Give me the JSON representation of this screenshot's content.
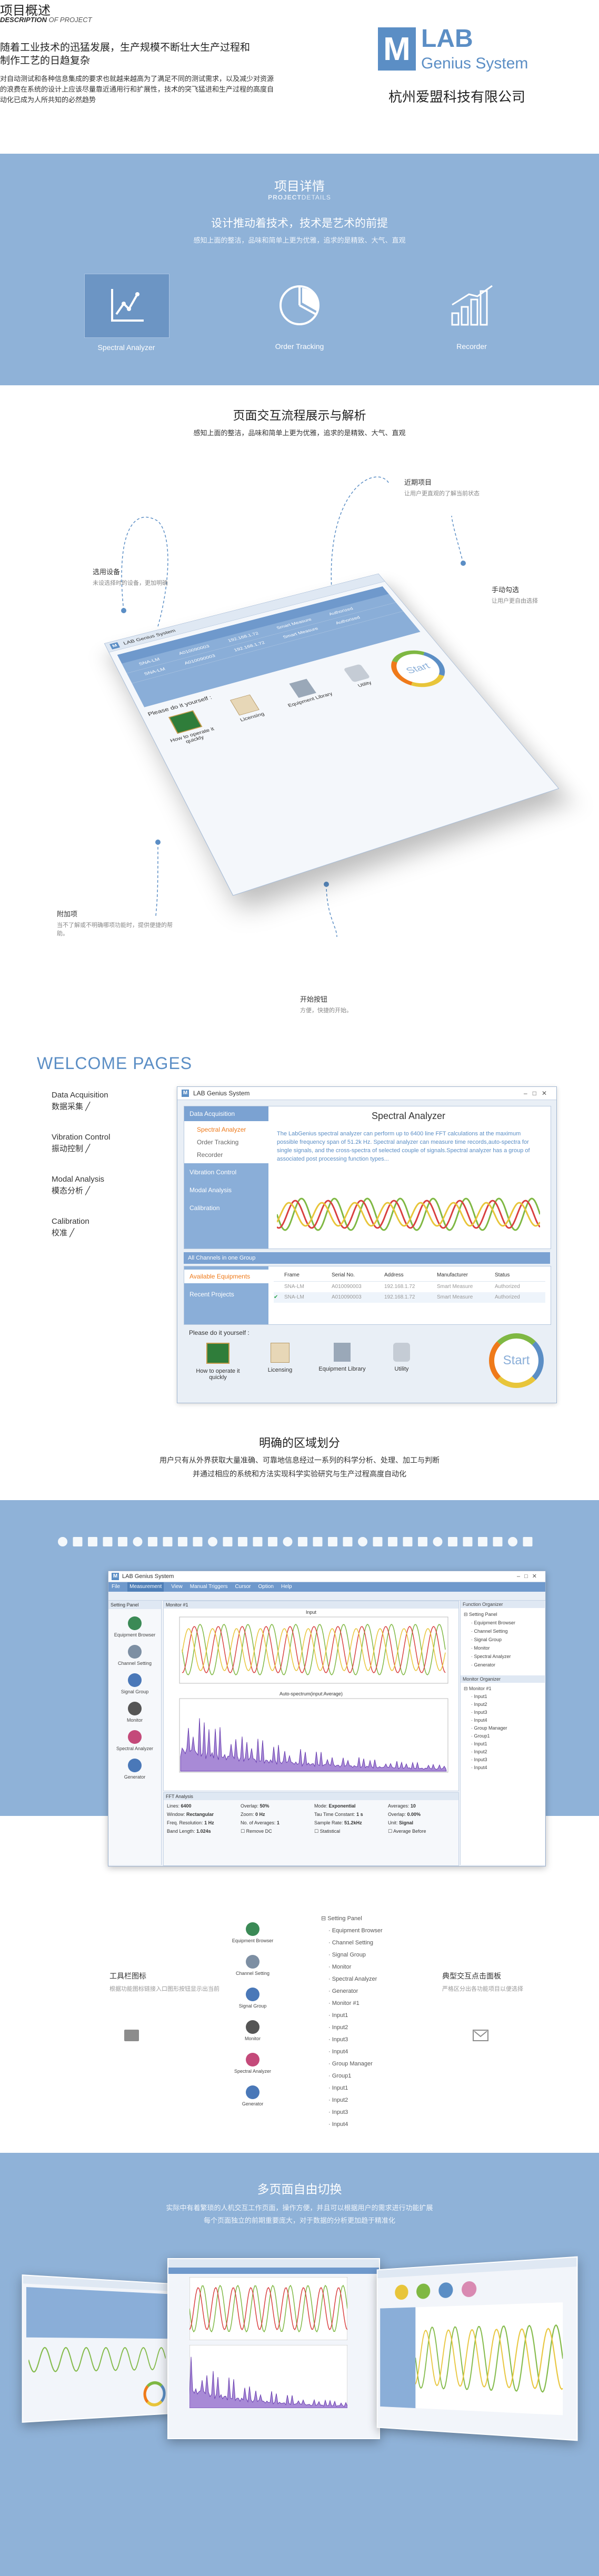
{
  "header": {
    "title": "项目概述",
    "subtitle_en_bold": "DESCRIPTION",
    "subtitle_en": "OF PROJECT",
    "lead": "随着工业技术的迅猛发展，生产规模不断壮大生产过程和制作工艺的日趋复杂",
    "body": "对自动测试和各种信息集成的要求也就越来越高为了满足不同的测试需求，以及减少对资源的浪费在系统的设计上应该尽量靠近通用行和扩展性，技术的突飞猛进和生产过程的高度自动化已成为人所共知的必然趋势"
  },
  "logo": {
    "mark": "M",
    "lab": "LAB",
    "genius": "Genius System",
    "company": "杭州爱盟科技有限公司"
  },
  "details": {
    "title": "项目详情",
    "subtitle_bold": "PROJECT",
    "subtitle": "DETAILS",
    "headline": "设计推动着技术，技术是艺术的前提",
    "desc": "感知上面的整洁，品味和简单上更为优雅，追求的是精致、大气、直观",
    "features": [
      {
        "label": "Spectral Analyzer",
        "icon": "chart-line-icon"
      },
      {
        "label": "Order Tracking",
        "icon": "pie-chart-icon"
      },
      {
        "label": "Recorder",
        "icon": "bar-chart-icon"
      }
    ]
  },
  "interaction": {
    "title": "页面交互流程展示与解析",
    "desc": "感知上面的整洁，品味和简单上更为优雅，追求的是精致、大气、直观",
    "notes": {
      "recent": {
        "title": "近期项目",
        "sub": "让用户更直观的了解当前状态"
      },
      "device": {
        "title": "选用设备",
        "sub": "未设选择时的设备，更加明确"
      },
      "manual": {
        "title": "手动勾选",
        "sub": "让用户更自由选择"
      },
      "append": {
        "title": "附加项",
        "sub": "当不了解或不明确哪项功能时，提供便捷的帮助。"
      },
      "start": {
        "title": "开始按钮",
        "sub": "方便，快捷的开始。"
      }
    },
    "window": {
      "title": "LAB Genius System",
      "rows": [
        "SNA-LM",
        "SNA-LM"
      ],
      "ids": [
        "A010090003",
        "A010090003"
      ],
      "ips": [
        "192.168.1.72",
        "192.168.1.72"
      ],
      "makers": [
        "Smart Measure",
        "Smart Measure"
      ],
      "status": [
        "Authorized",
        "Authorized"
      ],
      "help": "Please do it yourself :",
      "tiles": [
        "How to operate it quickly",
        "Licensing",
        "Equipment Library",
        "Utility"
      ],
      "start": "Start"
    }
  },
  "welcome": {
    "title": "WELCOME PAGES",
    "items": [
      {
        "en": "Data Acquisition",
        "cn": "数据采集 ╱"
      },
      {
        "en": "Vibration Control",
        "cn": "振动控制 ╱"
      },
      {
        "en": "Modal Analysis",
        "cn": "模态分析 ╱"
      },
      {
        "en": "Calibration",
        "cn": "校准 ╱"
      }
    ],
    "window": {
      "title": "LAB Genius System",
      "nav_header": "Data Acquisition",
      "nav": [
        "Spectral Analyzer",
        "Order Tracking",
        "Recorder"
      ],
      "nav2": [
        "Vibration Control",
        "Modal Analysis",
        "Calibration"
      ],
      "panel_title": "Spectral Analyzer",
      "panel_text": "The LabGenius spectral analyzer can perform up to 6400 line FFT calculations at the maximum possible frequency span of 51.2k Hz. Spectral analyzer can measure time records,auto-spectra for single signals, and the cross-spectra of selected couple of signals.Spectral analyzer has a group of associated post processing function types...",
      "group_bar": "All Channels in one Group",
      "avail": "Available Equipments",
      "recent": "Recent Projects",
      "cols": [
        "Frame",
        "Serial No.",
        "Address",
        "Manufacturer",
        "Status"
      ],
      "rows": [
        [
          "SNA-LM",
          "A010090003",
          "192.168.1.72",
          "Smart Measure",
          "Authorized"
        ],
        [
          "SNA-LM",
          "A010090003",
          "192.168.1.72",
          "Smart Measure",
          "Authorized"
        ]
      ],
      "help": "Please do it yourself :",
      "tiles": [
        "How to operate it quickly",
        "Licensing",
        "Equipment Library",
        "Utility"
      ],
      "start": "Start"
    }
  },
  "region": {
    "title": "明确的区域划分",
    "d1": "用户只有从外界获取大量准确、可靠地信息经过一系列的科学分析、处理、加工与判断",
    "d2": "并通过相应的系统和方法实现科学实验研究与生产过程高度自动化"
  },
  "workspace": {
    "title": "LAB Genius System",
    "menu": [
      "File",
      "Measurement",
      "View",
      "Manual Triggers",
      "Cursor",
      "Option",
      "Help"
    ],
    "setting_panel": "Setting Panel",
    "monitor": "Monitor #1",
    "chart1": "Input",
    "chart2": "Auto-spectrum(input:Average)",
    "tools": [
      "Equipment Browser",
      "Channel Setting",
      "Signal Group",
      "Monitor",
      "Spectral Analyzer",
      "Generator"
    ],
    "tree_title": "Function Organizer",
    "tree": [
      "Setting Panel",
      "Equipment Browser",
      "Channel Setting",
      "Signal Group",
      "Monitor",
      "Spectral Analyzer",
      "Generator"
    ],
    "tree2_title": "Monitor Organizer",
    "tree2": [
      "Monitor #1",
      "Input1",
      "Input2",
      "Input3",
      "Input4",
      "Group Manager",
      "Group1",
      "Input1",
      "Input2",
      "Input3",
      "Input4"
    ],
    "form": {
      "fft": "FFT Analysis",
      "lines": "Lines",
      "lines_v": "6400",
      "overlap": "Overlap",
      "overlap_v": "50%",
      "window": "Window",
      "window_v": "Rectangular",
      "zoom": "Zoom",
      "zoom_v": "0 Hz",
      "remove_dc": "Remove DC",
      "freq_res": "Freq. Resolution",
      "freq_res_v": "1 Hz",
      "avg": "No. of Averages",
      "avg_v": "1",
      "mode": "Mode",
      "mode_v": "Exponential",
      "sample": "Sample Rate",
      "sample_v": "51.2kHz",
      "band": "Band Length",
      "band_v": "1.024s",
      "averages": "Averages",
      "averages_v": "10",
      "stat": "Statistical",
      "tau": "Tau Time Constant",
      "tau_v": "1 s",
      "overlap2": "Overlap",
      "overlap2_v": "0.00%",
      "avg_after": "Average Before",
      "unit": "Unit",
      "unit_v": "Signal"
    }
  },
  "tool_section": {
    "left_title": "工具栏图标",
    "left_sub": "根据功能图标链接入口图形按钮显示出当前",
    "right_title": "典型交互点击面板",
    "right_sub": "严格区分出各功能项目以便选择",
    "tools": [
      "Equipment Browser",
      "Channel Setting",
      "Signal Group",
      "Monitor",
      "Spectral Analyzer",
      "Generator"
    ],
    "tree": [
      "Setting Panel",
      "Equipment Browser",
      "Channel Setting",
      "Signal Group",
      "Monitor",
      "Spectral Analyzer",
      "Generator",
      "Monitor #1",
      "Input1",
      "Input2",
      "Input3",
      "Input4",
      "Group Manager",
      "Group1",
      "Input1",
      "Input2",
      "Input3",
      "Input4"
    ]
  },
  "multi": {
    "title": "多页面自由切换",
    "d1": "实际中有着繁琐的人机交互工作页面，操作方便，并且可以根据用户的需求进行功能扩展",
    "d2": "每个页面独立的前期重要庞大，对于数据的分析更加趋于精准化"
  },
  "colors": {
    "brand": "#5b8ec5",
    "band": "#8fb2d8",
    "accent_orange": "#ef7a1a",
    "wave_green": "#7fb843",
    "wave_red": "#d94040",
    "wave_yellow": "#e8c53a",
    "spectrum_purple": "#8a5cc0"
  }
}
